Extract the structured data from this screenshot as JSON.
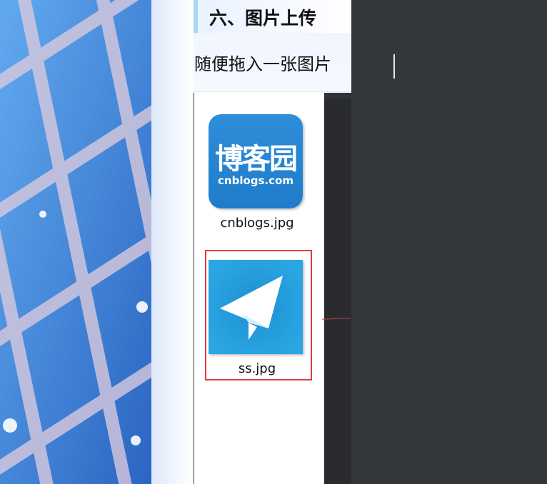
{
  "header": {
    "section_title": "六、图片上传",
    "subtitle": "随便拖入一张图片"
  },
  "files": [
    {
      "thumb_text": "博客园",
      "thumb_subtext": "cnblogs.com",
      "name": "cnblogs.jpg"
    },
    {
      "name": "ss.jpg",
      "selected": true
    }
  ],
  "colors": {
    "selection_border": "#e23b3b",
    "dark_panel": "#33373b",
    "thumb_blue": "#2aa7e3",
    "cnblogs_blue": "#1e7ccc"
  },
  "icons": {
    "ss_thumb_icon": "paper-plane-icon"
  }
}
